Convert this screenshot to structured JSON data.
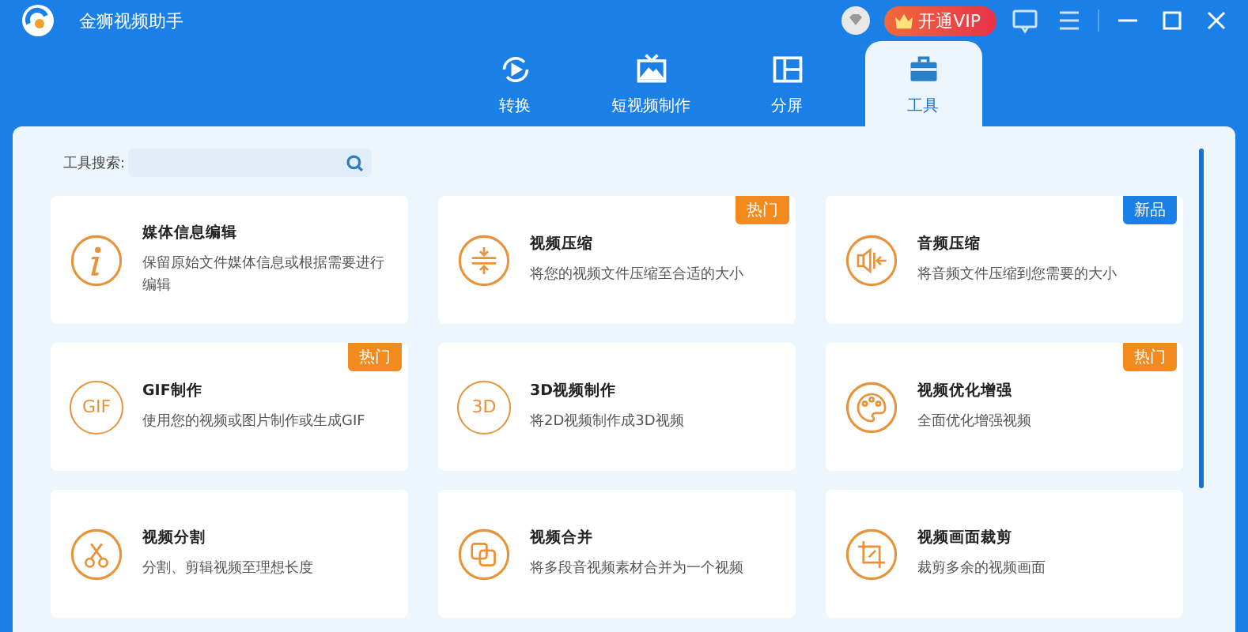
{
  "window": {
    "title": "金狮视频助手",
    "vip_button": "开通VIP"
  },
  "tabs": [
    {
      "label": "转换",
      "selected": false
    },
    {
      "label": "短视频制作",
      "selected": false
    },
    {
      "label": "分屏",
      "selected": false
    },
    {
      "label": "工具",
      "selected": true
    }
  ],
  "search": {
    "label": "工具搜索:"
  },
  "tools": [
    {
      "title": "媒体信息编辑",
      "description": "保留原始文件媒体信息或根据需要进行编辑"
    },
    {
      "title": "视频压缩",
      "description": "将您的视频文件压缩至合适的大小",
      "badge": {
        "kind": "hot",
        "text": "热门"
      }
    },
    {
      "title": "音频压缩",
      "description": "将音频文件压缩到您需要的大小",
      "badge": {
        "kind": "new",
        "text": "新品"
      }
    },
    {
      "title": "GIF制作",
      "description": "使用您的视频或图片制作或生成GIF",
      "icon_text": "GIF",
      "badge": {
        "kind": "hot",
        "text": "热门"
      }
    },
    {
      "title": "3D视频制作",
      "description": "将2D视频制作成3D视频",
      "icon_text": "3D"
    },
    {
      "title": "视频优化增强",
      "description": "全面优化增强视频",
      "badge": {
        "kind": "hot",
        "text": "热门"
      }
    },
    {
      "title": "视频分割",
      "description": "分割、剪辑视频至理想长度"
    },
    {
      "title": "视频合并",
      "description": "将多段音视频素材合并为一个视频"
    },
    {
      "title": "视频画面裁剪",
      "description": "裁剪多余的视频画面"
    }
  ]
}
